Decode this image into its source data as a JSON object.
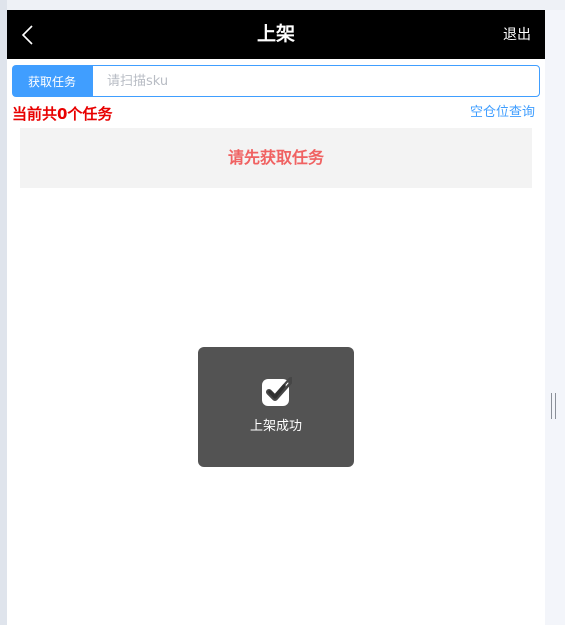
{
  "header": {
    "back_icon": "chevron-left-icon",
    "title": "上架",
    "exit_label": "退出"
  },
  "toolbar": {
    "fetch_task_label": "获取任务",
    "sku_placeholder": "请扫描sku",
    "sku_value": ""
  },
  "summary": {
    "task_count_text": "当前共0个任务",
    "empty_location_query_label": "空仓位查询"
  },
  "task_panel": {
    "hint": "请先获取任务"
  },
  "toast": {
    "icon": "check-square-icon",
    "message": "上架成功"
  },
  "colors": {
    "nav_bg": "#000000",
    "accent": "#409eff",
    "task_count": "#e80000",
    "hint": "#f06262",
    "toast_bg": "#464646"
  }
}
